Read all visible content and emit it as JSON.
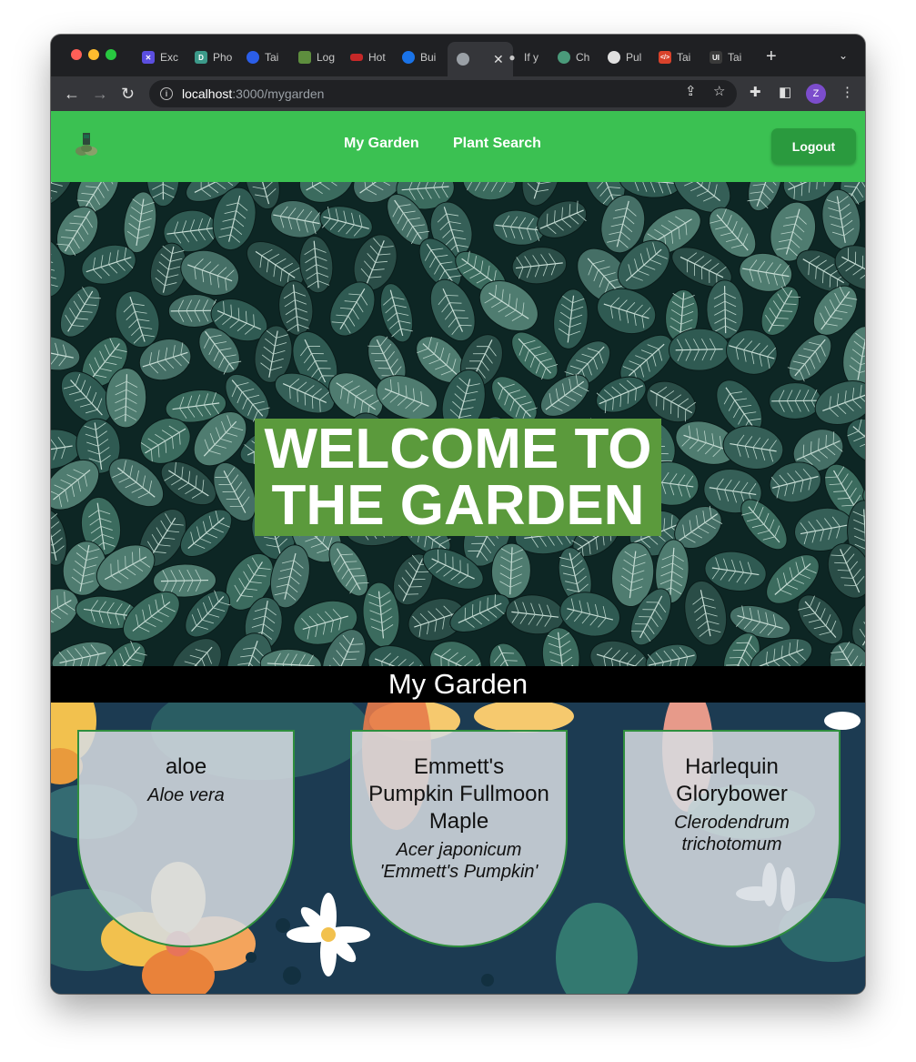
{
  "browser": {
    "tabs": [
      {
        "label": "Exc",
        "favicon_color": "#5b4ee0"
      },
      {
        "label": "Pho",
        "favicon_color": "#3c9a8a"
      },
      {
        "label": "Tai",
        "favicon_color": "#2b5ee8"
      },
      {
        "label": "Log",
        "favicon_color": "#5e8e3e"
      },
      {
        "label": "Hot",
        "favicon_color": "#c62828"
      },
      {
        "label": "Bui",
        "favicon_color": "#1a73e8"
      },
      {
        "label": "",
        "favicon_color": "#9aa0a6",
        "active": true
      },
      {
        "label": "If y",
        "favicon_color": "#9aa0a6"
      },
      {
        "label": "Ch",
        "favicon_color": "#4a9a7a"
      },
      {
        "label": "Pul",
        "favicon_color": "#e0e0e0"
      },
      {
        "label": "Tai",
        "favicon_color": "#d9422b"
      },
      {
        "label": "Tai",
        "favicon_color": "#3a3a3a"
      }
    ],
    "new_tab": "+",
    "url_host": "localhost",
    "url_path": ":3000/mygarden",
    "profile_initial": "Z"
  },
  "nav": {
    "links": [
      "My Garden",
      "Plant Search"
    ],
    "logout": "Logout",
    "bg_color": "#3bc152"
  },
  "hero": {
    "title_line1": "WELCOME TO",
    "title_line2": "THE GARDEN",
    "title_bg": "#5b9a3c"
  },
  "section": {
    "title": "My Garden"
  },
  "plants": [
    {
      "common": "aloe",
      "scientific": "Aloe vera"
    },
    {
      "common": "Emmett's Pumpkin Fullmoon Maple",
      "scientific": "Acer japonicum 'Emmett's Pumpkin'"
    },
    {
      "common": "Harlequin Glorybower",
      "scientific": "Clerodendrum trichotomum"
    }
  ]
}
